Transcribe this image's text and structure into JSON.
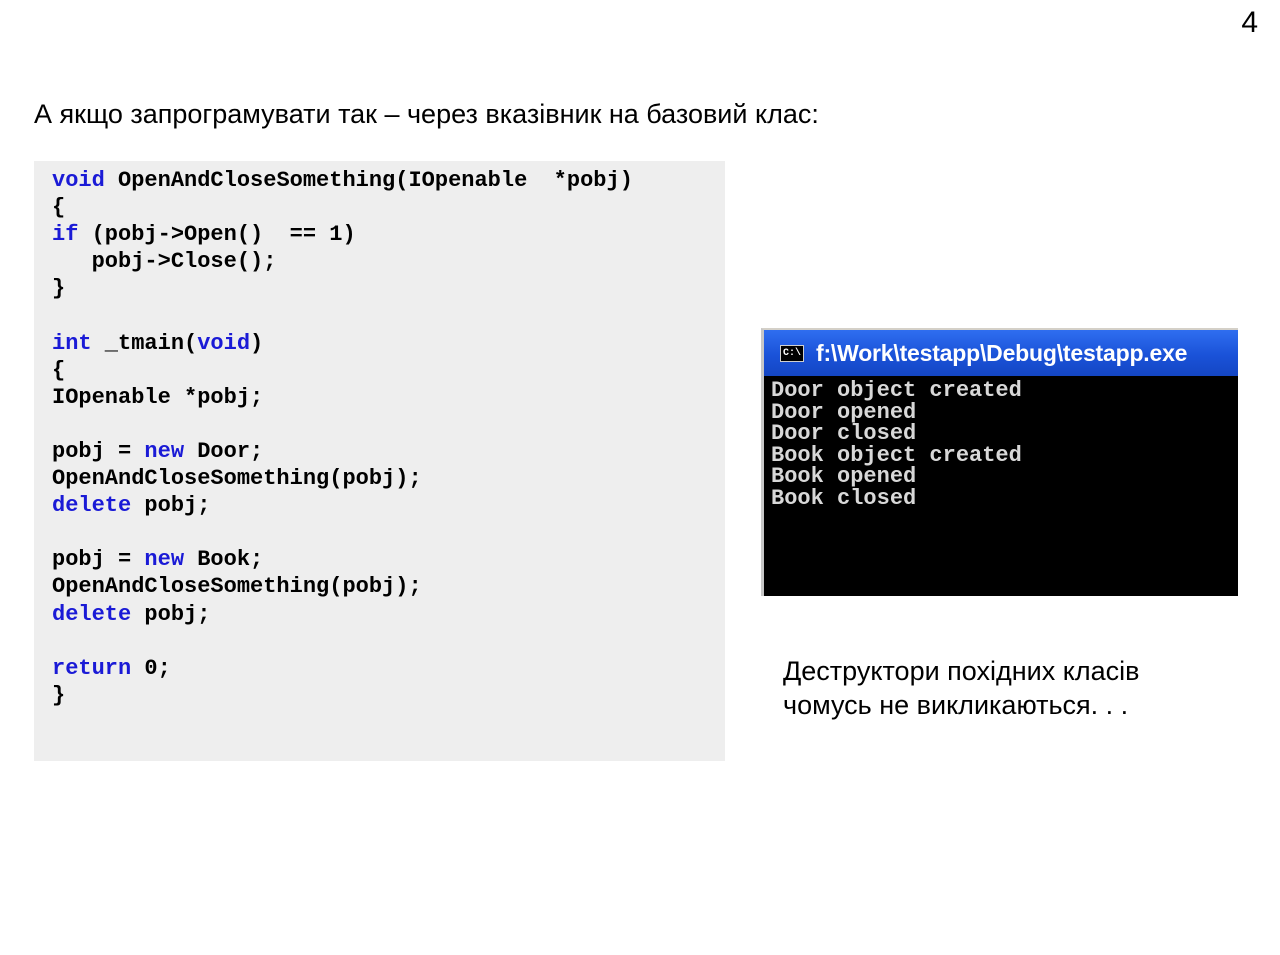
{
  "slide": {
    "number": "4",
    "heading": "А якщо запрограмувати  так – через вказівник на базовий клас:"
  },
  "code": {
    "lines": [
      [
        {
          "t": "void",
          "kw": true
        },
        {
          "t": " OpenAndCloseSomething(IOpenable  *pobj)"
        }
      ],
      [
        {
          "t": "{"
        }
      ],
      [
        {
          "t": "if",
          "kw": true
        },
        {
          "t": " (pobj->Open()  == 1)"
        }
      ],
      [
        {
          "t": "   pobj->Close();"
        }
      ],
      [
        {
          "t": "}"
        }
      ],
      [],
      [
        {
          "t": "int",
          "kw": true
        },
        {
          "t": " _tmain("
        },
        {
          "t": "void",
          "kw": true
        },
        {
          "t": ")"
        }
      ],
      [
        {
          "t": "{"
        }
      ],
      [
        {
          "t": "IOpenable *pobj;"
        }
      ],
      [],
      [
        {
          "t": "pobj = "
        },
        {
          "t": "new",
          "kw": true
        },
        {
          "t": " Door;"
        }
      ],
      [
        {
          "t": "OpenAndCloseSomething(pobj);"
        }
      ],
      [
        {
          "t": "delete",
          "kw": true
        },
        {
          "t": " pobj;"
        }
      ],
      [],
      [
        {
          "t": "pobj = "
        },
        {
          "t": "new",
          "kw": true
        },
        {
          "t": " Book;"
        }
      ],
      [
        {
          "t": "OpenAndCloseSomething(pobj);"
        }
      ],
      [
        {
          "t": "delete",
          "kw": true
        },
        {
          "t": " pobj;"
        }
      ],
      [],
      [
        {
          "t": "return",
          "kw": true
        },
        {
          "t": " 0;"
        }
      ],
      [
        {
          "t": "}"
        }
      ]
    ],
    "keyword_color": "#1a1ad6"
  },
  "console": {
    "icon_label": "C:\\",
    "title": "f:\\Work\\testapp\\Debug\\testapp.exe",
    "output": [
      "Door object created",
      "Door opened",
      "Door closed",
      "Book object created",
      "Book opened",
      "Book closed"
    ],
    "titlebar_color": "#1a52d8"
  },
  "note": {
    "line1": "Деструктори похідних класів",
    "line2": "чомусь не викликаються. . ."
  }
}
